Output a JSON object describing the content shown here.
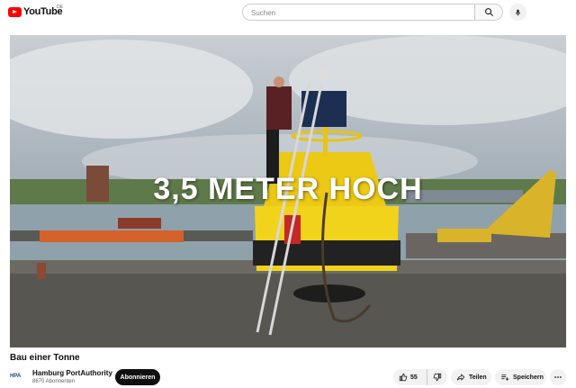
{
  "header": {
    "logo_text": "YouTube",
    "country_code": "DE",
    "search_placeholder": "Suchen",
    "icons": [
      "youtube-logo-icon",
      "search-icon",
      "mic-icon"
    ]
  },
  "video": {
    "overlay_text": "3,5 METER HOCH",
    "title": "Bau einer Tonne"
  },
  "channel": {
    "logo_text": "HPA",
    "name": "Hamburg PortAuthority",
    "subscribers": "8670 Abonnenten",
    "subscribe_label": "Abonnieren"
  },
  "actions": {
    "like_count": "55",
    "share_label": "Teilen",
    "save_label": "Speichern",
    "icons": [
      "thumbs-up-icon",
      "thumbs-down-icon",
      "share-icon",
      "playlist-add-icon",
      "more-icon"
    ]
  },
  "colors": {
    "brand_red": "#ff0000",
    "buoy_yellow": "#f2d31b",
    "subscribe_bg": "#0f0f0f"
  }
}
